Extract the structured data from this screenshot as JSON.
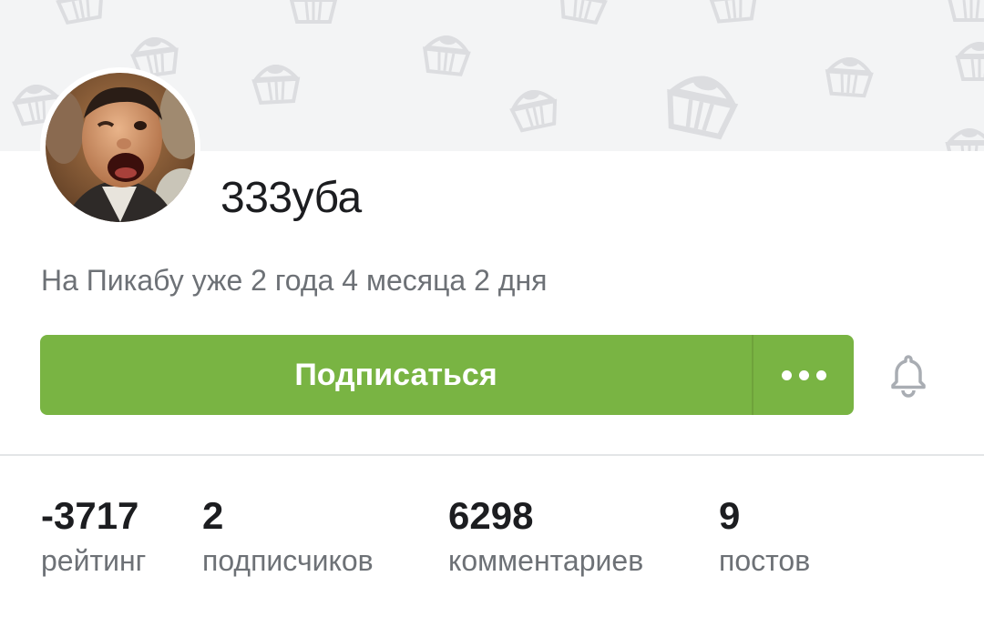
{
  "profile": {
    "username": "333уба",
    "since": "На Пикабу уже 2 года 4 месяца 2 дня",
    "avatar": "user-avatar-photo"
  },
  "actions": {
    "subscribe_label": "Подписаться",
    "more_icon": "more-dots-icon",
    "bell_icon": "bell-icon"
  },
  "stats": {
    "rating": {
      "value": "-3717",
      "label": "рейтинг"
    },
    "subscribers": {
      "value": "2",
      "label": "подписчиков"
    },
    "comments": {
      "value": "6298",
      "label": "комментариев"
    },
    "posts": {
      "value": "9",
      "label": "постов"
    }
  },
  "colors": {
    "accent": "#79b443",
    "cover_bg": "#f3f4f5",
    "muted_text": "#6d7176",
    "primary_text": "#1c1d20"
  }
}
